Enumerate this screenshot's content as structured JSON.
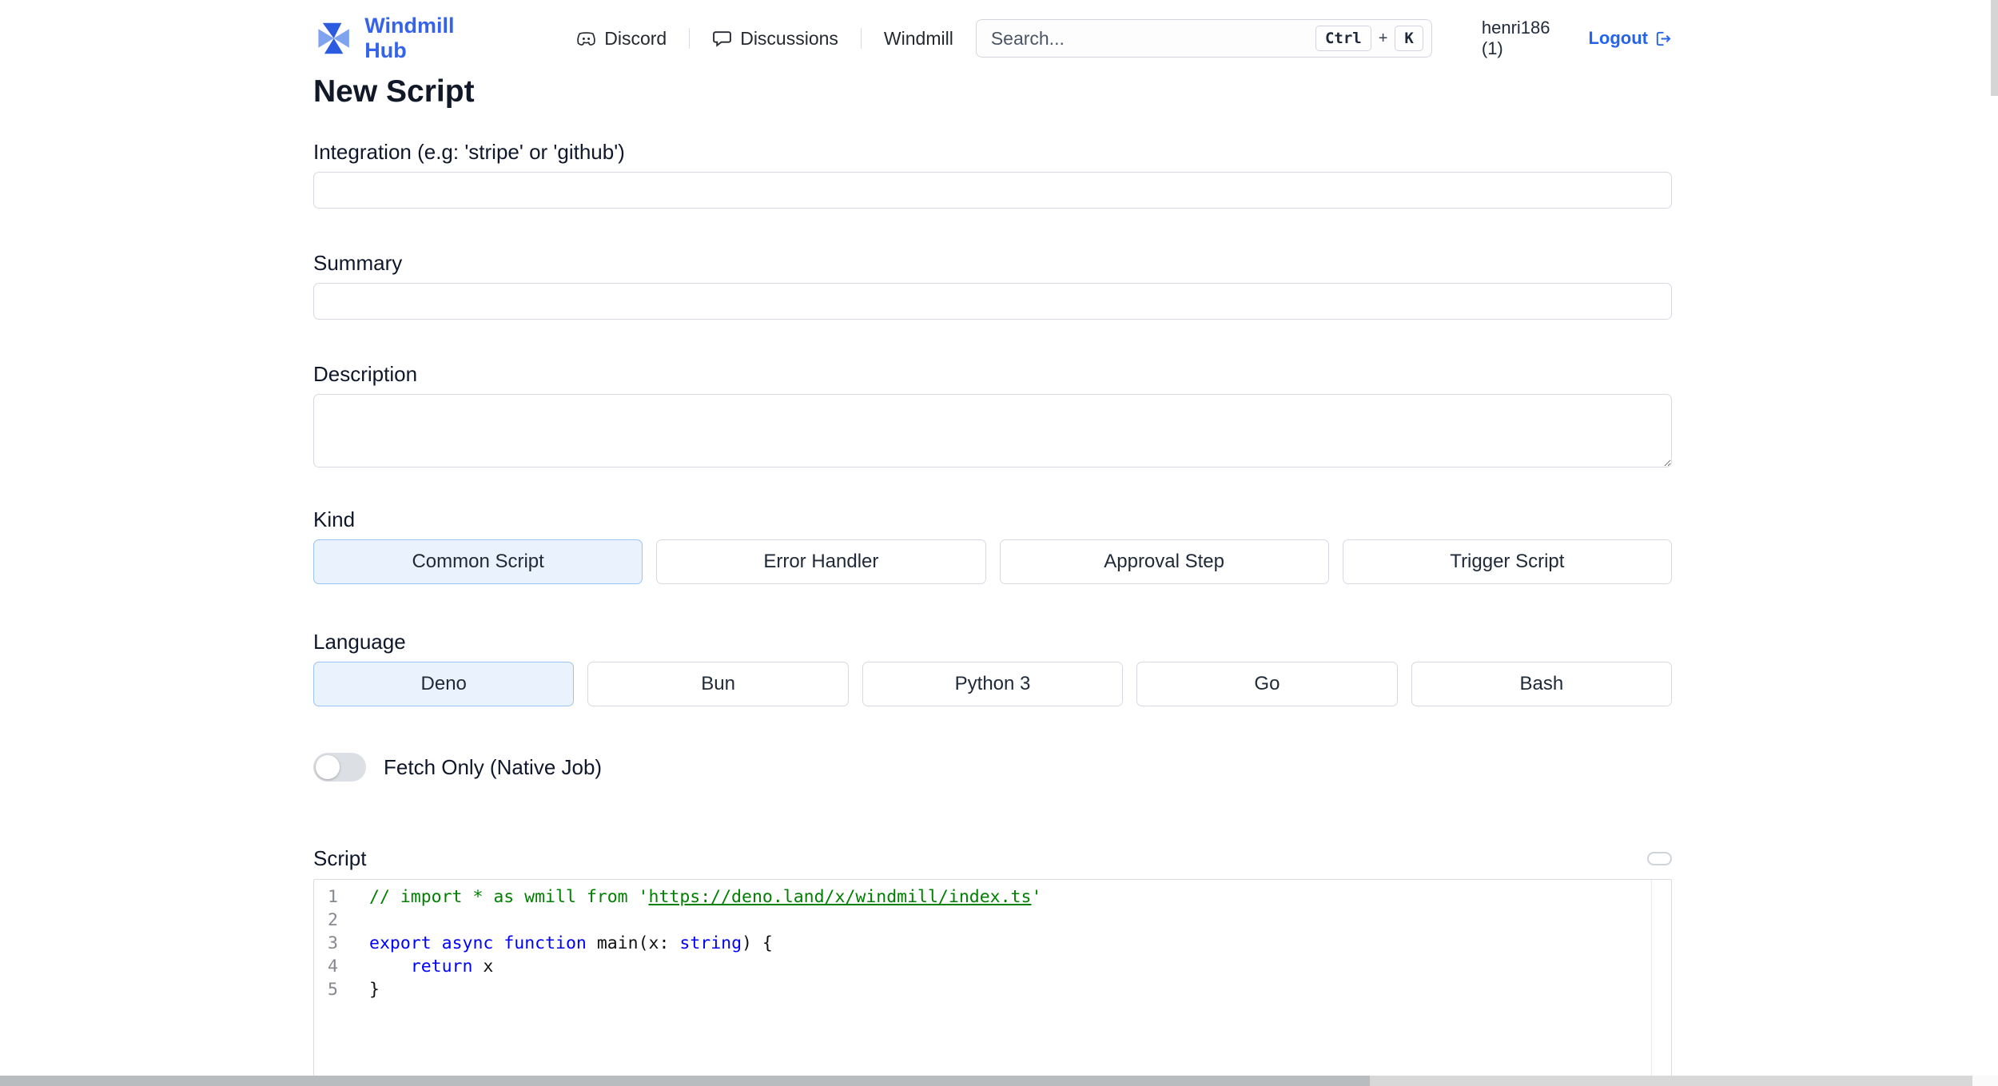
{
  "nav": {
    "brand": "Windmill Hub",
    "links": [
      {
        "label": "Discord"
      },
      {
        "label": "Discussions"
      },
      {
        "label": "Windmill"
      }
    ],
    "search": {
      "placeholder": "Search...",
      "kbd1": "Ctrl",
      "plus": "+",
      "kbd2": "K"
    },
    "user": "henri186 (1)",
    "logout": "Logout"
  },
  "page": {
    "title": "New Script"
  },
  "form": {
    "integration_label": "Integration (e.g: 'stripe' or 'github')",
    "integration_value": "",
    "summary_label": "Summary",
    "summary_value": "",
    "description_label": "Description",
    "description_value": "",
    "kind_label": "Kind",
    "kinds": [
      {
        "label": "Common Script",
        "selected": true
      },
      {
        "label": "Error Handler",
        "selected": false
      },
      {
        "label": "Approval Step",
        "selected": false
      },
      {
        "label": "Trigger Script",
        "selected": false
      }
    ],
    "language_label": "Language",
    "languages": [
      {
        "label": "Deno",
        "selected": true
      },
      {
        "label": "Bun",
        "selected": false
      },
      {
        "label": "Python 3",
        "selected": false
      },
      {
        "label": "Go",
        "selected": false
      },
      {
        "label": "Bash",
        "selected": false
      }
    ],
    "fetch_only_label": "Fetch Only (Native Job)",
    "fetch_only_on": false,
    "script_label": "Script"
  },
  "editor": {
    "lines": [
      {
        "num": "1",
        "tokens": [
          {
            "t": "// import * as wmill from '",
            "c": "comment"
          },
          {
            "t": "https://deno.land/x/windmill/index.ts",
            "c": "comment-link"
          },
          {
            "t": "'",
            "c": "comment"
          }
        ]
      },
      {
        "num": "2",
        "tokens": []
      },
      {
        "num": "3",
        "tokens": [
          {
            "t": "export",
            "c": "kw"
          },
          {
            "t": " ",
            "c": "plain"
          },
          {
            "t": "async",
            "c": "kw"
          },
          {
            "t": " ",
            "c": "plain"
          },
          {
            "t": "function",
            "c": "kw"
          },
          {
            "t": " main(x: ",
            "c": "plain"
          },
          {
            "t": "string",
            "c": "kw"
          },
          {
            "t": ") {",
            "c": "plain"
          }
        ]
      },
      {
        "num": "4",
        "tokens": [
          {
            "t": "    ",
            "c": "plain"
          },
          {
            "t": "return",
            "c": "kw"
          },
          {
            "t": " x",
            "c": "plain"
          }
        ]
      },
      {
        "num": "5",
        "tokens": [
          {
            "t": "}",
            "c": "plain"
          }
        ]
      }
    ]
  },
  "colors": {
    "brand_blue": "#3563e9",
    "link_blue": "#2563eb",
    "selected_bg": "#eaf2fe",
    "selected_border": "#9cc3f5",
    "comment_green": "#008000",
    "keyword_blue": "#0000ff"
  }
}
